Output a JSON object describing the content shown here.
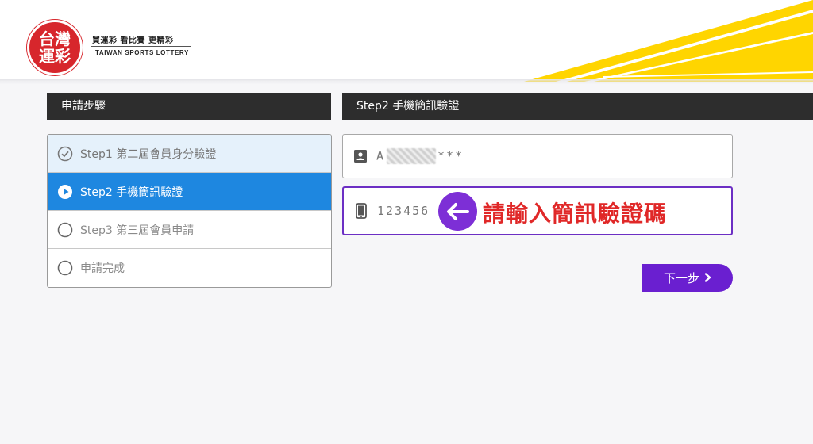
{
  "logo": {
    "badge_line1": "台灣",
    "badge_line2": "運彩",
    "slogan": "買運彩  看比賽  更精彩",
    "english": "TAIWAN SPORTS LOTTERY"
  },
  "left_panel": {
    "title": "申請步驟",
    "steps": [
      {
        "label": "Step1 第二屆會員身分驗證",
        "state": "done"
      },
      {
        "label": "Step2 手機簡訊驗證",
        "state": "active"
      },
      {
        "label": "Step3 第三屆會員申請",
        "state": "pending"
      },
      {
        "label": "申請完成",
        "state": "pending"
      }
    ]
  },
  "right_panel": {
    "title": "Step2 手機簡訊驗證",
    "id_field": {
      "prefix": "A",
      "suffix": "***"
    },
    "sms_field": {
      "value": "123456"
    },
    "annotation": "請輸入簡訊驗證碼",
    "next_label": "下一步"
  },
  "colors": {
    "accent_yellow": "#ffd500",
    "active_step": "#1e87e0",
    "button_purple": "#6a1fd0",
    "annotation_red": "#e02828",
    "logo_red": "#d7262c"
  },
  "icons": {
    "step_done": "check-circle-icon",
    "step_active": "play-circle-icon",
    "step_pending": "empty-circle-icon",
    "id_field": "id-card-icon",
    "sms_field": "phone-icon",
    "annotation": "arrow-left-icon",
    "next": "chevron-right-icon"
  }
}
